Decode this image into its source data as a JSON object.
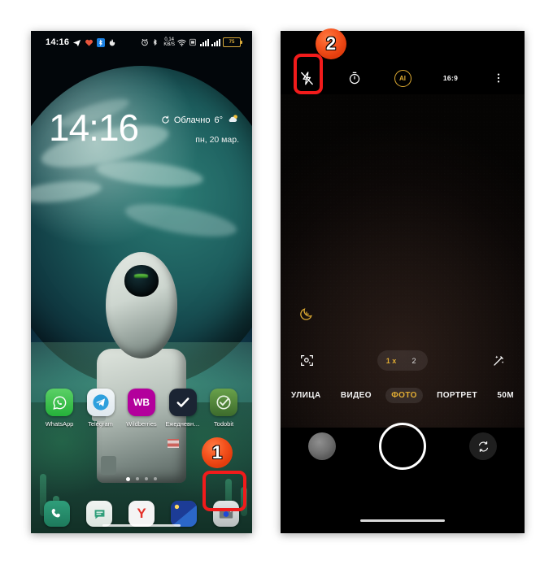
{
  "left_phone": {
    "name": "android-lockscreen",
    "status_bar": {
      "time": "14:16",
      "icons_left": [
        "telegram-icon",
        "heart-icon",
        "bluetooth-badge-icon",
        "fire-icon"
      ],
      "icons_right": [
        "alarm-icon",
        "bluetooth-icon",
        "data-rate-icon",
        "wifi-icon",
        "sim-icon",
        "signal-icon",
        "signal-icon",
        "battery-icon"
      ],
      "data_rate_value": "0.14",
      "data_rate_unit": "KB/S",
      "bluetooth_badge": "1",
      "battery_percent": "75"
    },
    "clock": "14:16",
    "weather": {
      "condition": "Облачно",
      "temperature": "6°",
      "refresh_icon": "refresh-icon",
      "weather_icon": "partly-cloudy-icon"
    },
    "date": "пн, 20 мар.",
    "apps": [
      {
        "label": "WhatsApp",
        "icon": "whatsapp-icon"
      },
      {
        "label": "Telegram",
        "icon": "telegram-icon"
      },
      {
        "label": "Wildberries",
        "icon": "wildberries-icon",
        "glyph": "WB"
      },
      {
        "label": "Ежедневн…",
        "icon": "checkmark-icon"
      },
      {
        "label": "Todobit",
        "icon": "todobit-icon"
      }
    ],
    "page_dots": {
      "count": 4,
      "active_index": 0
    },
    "dock": [
      {
        "label": "Телефон",
        "icon": "phone-icon"
      },
      {
        "label": "Сообщения",
        "icon": "messages-icon"
      },
      {
        "label": "Яндекс",
        "icon": "yandex-icon",
        "glyph": "Y"
      },
      {
        "label": "Галерея",
        "icon": "gallery-icon"
      },
      {
        "label": "Камера",
        "icon": "camera-icon"
      }
    ],
    "nav_bar": "home-indicator"
  },
  "right_phone": {
    "name": "android-camera-app",
    "top_bar": [
      {
        "label": "Вспышка выкл.",
        "icon": "flash-off-icon",
        "highlighted": true
      },
      {
        "label": "Таймер",
        "icon": "timer-icon"
      },
      {
        "label": "AI",
        "icon": "ai-icon",
        "glyph": "AI"
      },
      {
        "label": "Соотношение сторон",
        "icon": "aspect-ratio-icon",
        "glyph": "16:9"
      },
      {
        "label": "Ещё",
        "icon": "more-vertical-icon"
      }
    ],
    "night_mode_icon": "moon-icon",
    "scan_icon": "scan-document-icon",
    "filters_icon": "magic-wand-icon",
    "zoom_levels": [
      {
        "label": "1 x",
        "active": true
      },
      {
        "label": "2",
        "active": false
      }
    ],
    "modes": [
      {
        "label": "УЛИЦА",
        "active": false
      },
      {
        "label": "ВИДЕО",
        "active": false
      },
      {
        "label": "ФОТО",
        "active": true
      },
      {
        "label": "ПОРТРЕТ",
        "active": false
      },
      {
        "label": "50M",
        "active": false
      }
    ],
    "bottom": {
      "gallery_thumb": "gallery-thumbnail",
      "shutter": "shutter-button",
      "switch_camera": "switch-camera-icon"
    },
    "nav_bar": "home-indicator"
  },
  "annotations": {
    "step_1": {
      "label": "1",
      "target": "camera-dock-icon",
      "color": "#f4521d"
    },
    "step_2": {
      "label": "2",
      "target": "flash-toggle-icon",
      "color": "#f4521d"
    },
    "highlight_color": "#f21b1b"
  }
}
